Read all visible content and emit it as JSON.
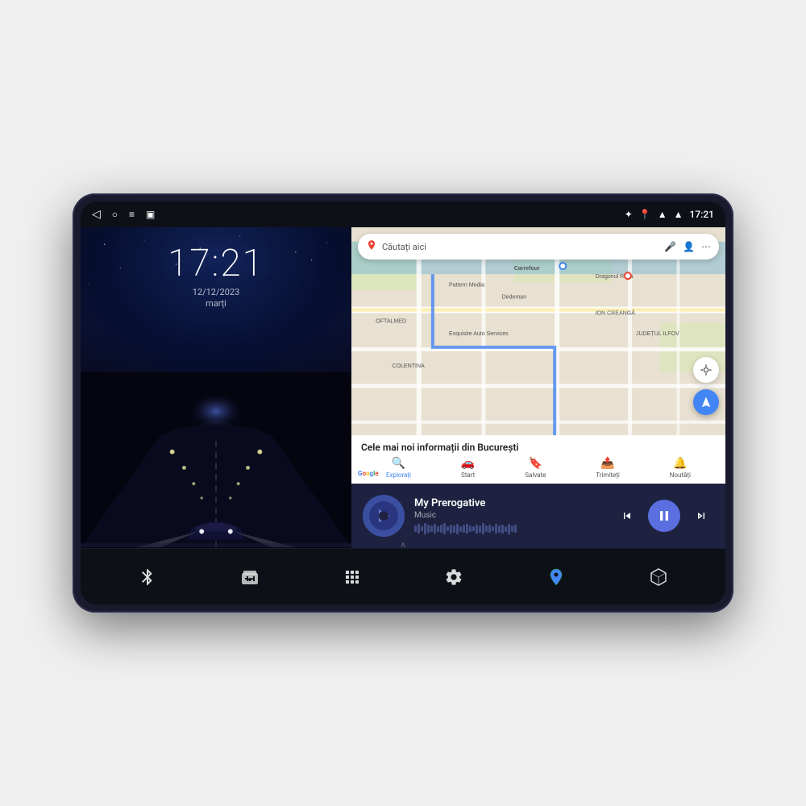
{
  "device": {
    "screen": {
      "status_bar": {
        "time": "17:21",
        "left_icons": [
          "back-arrow",
          "circle",
          "menu",
          "square"
        ],
        "right_icons": [
          "bluetooth",
          "wifi",
          "signal"
        ]
      },
      "left_panel": {
        "time": "17:21",
        "date": "12/12/2023",
        "day": "marți"
      },
      "right_panel": {
        "map": {
          "search_placeholder": "Căutați aici",
          "info_title": "Cele mai noi informații din București",
          "nav_tabs": [
            {
              "label": "Explorați",
              "active": true
            },
            {
              "label": "Start",
              "active": false
            },
            {
              "label": "Salvate",
              "active": false
            },
            {
              "label": "Trimiteți",
              "active": false
            },
            {
              "label": "Noutăți",
              "active": false
            }
          ]
        },
        "music": {
          "title": "My Prerogative",
          "subtitle": "Music",
          "controls": {
            "prev_label": "⏮",
            "play_label": "⏸",
            "next_label": "⏭"
          }
        }
      },
      "bottom_nav": {
        "items": [
          {
            "icon": "bluetooth",
            "symbol": "⚡"
          },
          {
            "icon": "radio",
            "symbol": "📻"
          },
          {
            "icon": "apps",
            "symbol": "⊞"
          },
          {
            "icon": "settings",
            "symbol": "⚙"
          },
          {
            "icon": "maps",
            "symbol": "📍"
          },
          {
            "icon": "cube",
            "symbol": "🎲"
          }
        ]
      }
    }
  },
  "colors": {
    "accent": "#4285f4",
    "music_accent": "#5b6fe0",
    "dark_bg": "#0d1117",
    "panel_bg": "#1e2240"
  }
}
